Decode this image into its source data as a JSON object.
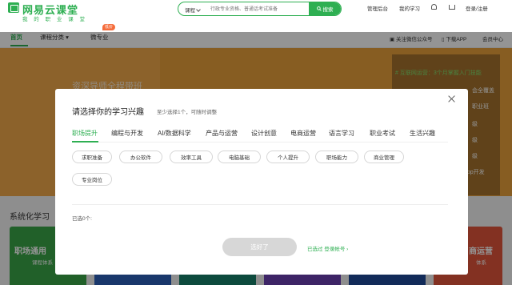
{
  "header": {
    "logo_text": "网易云课堂",
    "logo_sub": "我 的 职 业 课 堂",
    "search": {
      "category": "课程",
      "placeholder": "行政专业资格、普通话考试准备",
      "button": "搜索"
    },
    "links": [
      "管理后台",
      "我的学习",
      "登录/注册"
    ]
  },
  "nav": {
    "items": [
      "首页",
      "课程分类",
      "微专业"
    ],
    "hot_badge": "低价",
    "right": [
      "关注微信公众号",
      "下载APP",
      "会员中心"
    ]
  },
  "banner": {
    "text": "资深导师全程带班",
    "promo": [
      "# 互联网运营：3个月掌握入门技能",
      "会全覆盖",
      "职业班",
      "级",
      "级",
      "级",
      "app开发"
    ]
  },
  "section": {
    "title": "系统化学习",
    "cards": [
      {
        "title": "职场通用",
        "sub": "课程体系",
        "color": "#3aa648"
      },
      {
        "title": "",
        "sub": "",
        "color": "#2b5fb8"
      },
      {
        "title": "",
        "sub": "",
        "color": "#17806a"
      },
      {
        "title": "",
        "sub": "",
        "color": "#6a3fb0"
      },
      {
        "title": "",
        "sub": "",
        "color": "#1f4b99"
      },
      {
        "title": "商运营",
        "sub": "体系",
        "color": "#e2553c"
      }
    ]
  },
  "modal": {
    "title": "请选择你的学习兴趣",
    "hint": "至少选择1个，可随时调整",
    "tabs": [
      "职场提升",
      "编程与开发",
      "AI/数据科学",
      "产品与运营",
      "设计创意",
      "电商运营",
      "语言学习",
      "职业考试",
      "生活兴趣"
    ],
    "active_tab": 0,
    "chips": [
      "求职准备",
      "办公软件",
      "效率工具",
      "电脑基础",
      "个人提升",
      "职场能力",
      "商业管理",
      "专业岗位"
    ],
    "selected_label": "已选0个:",
    "done_button": "选好了",
    "login_prefix": "已选过",
    "login_link": "登录帐号",
    "login_arrow": "›"
  },
  "colors": {
    "brand": "#2eaf52",
    "disabled": "#d7d7d7"
  }
}
